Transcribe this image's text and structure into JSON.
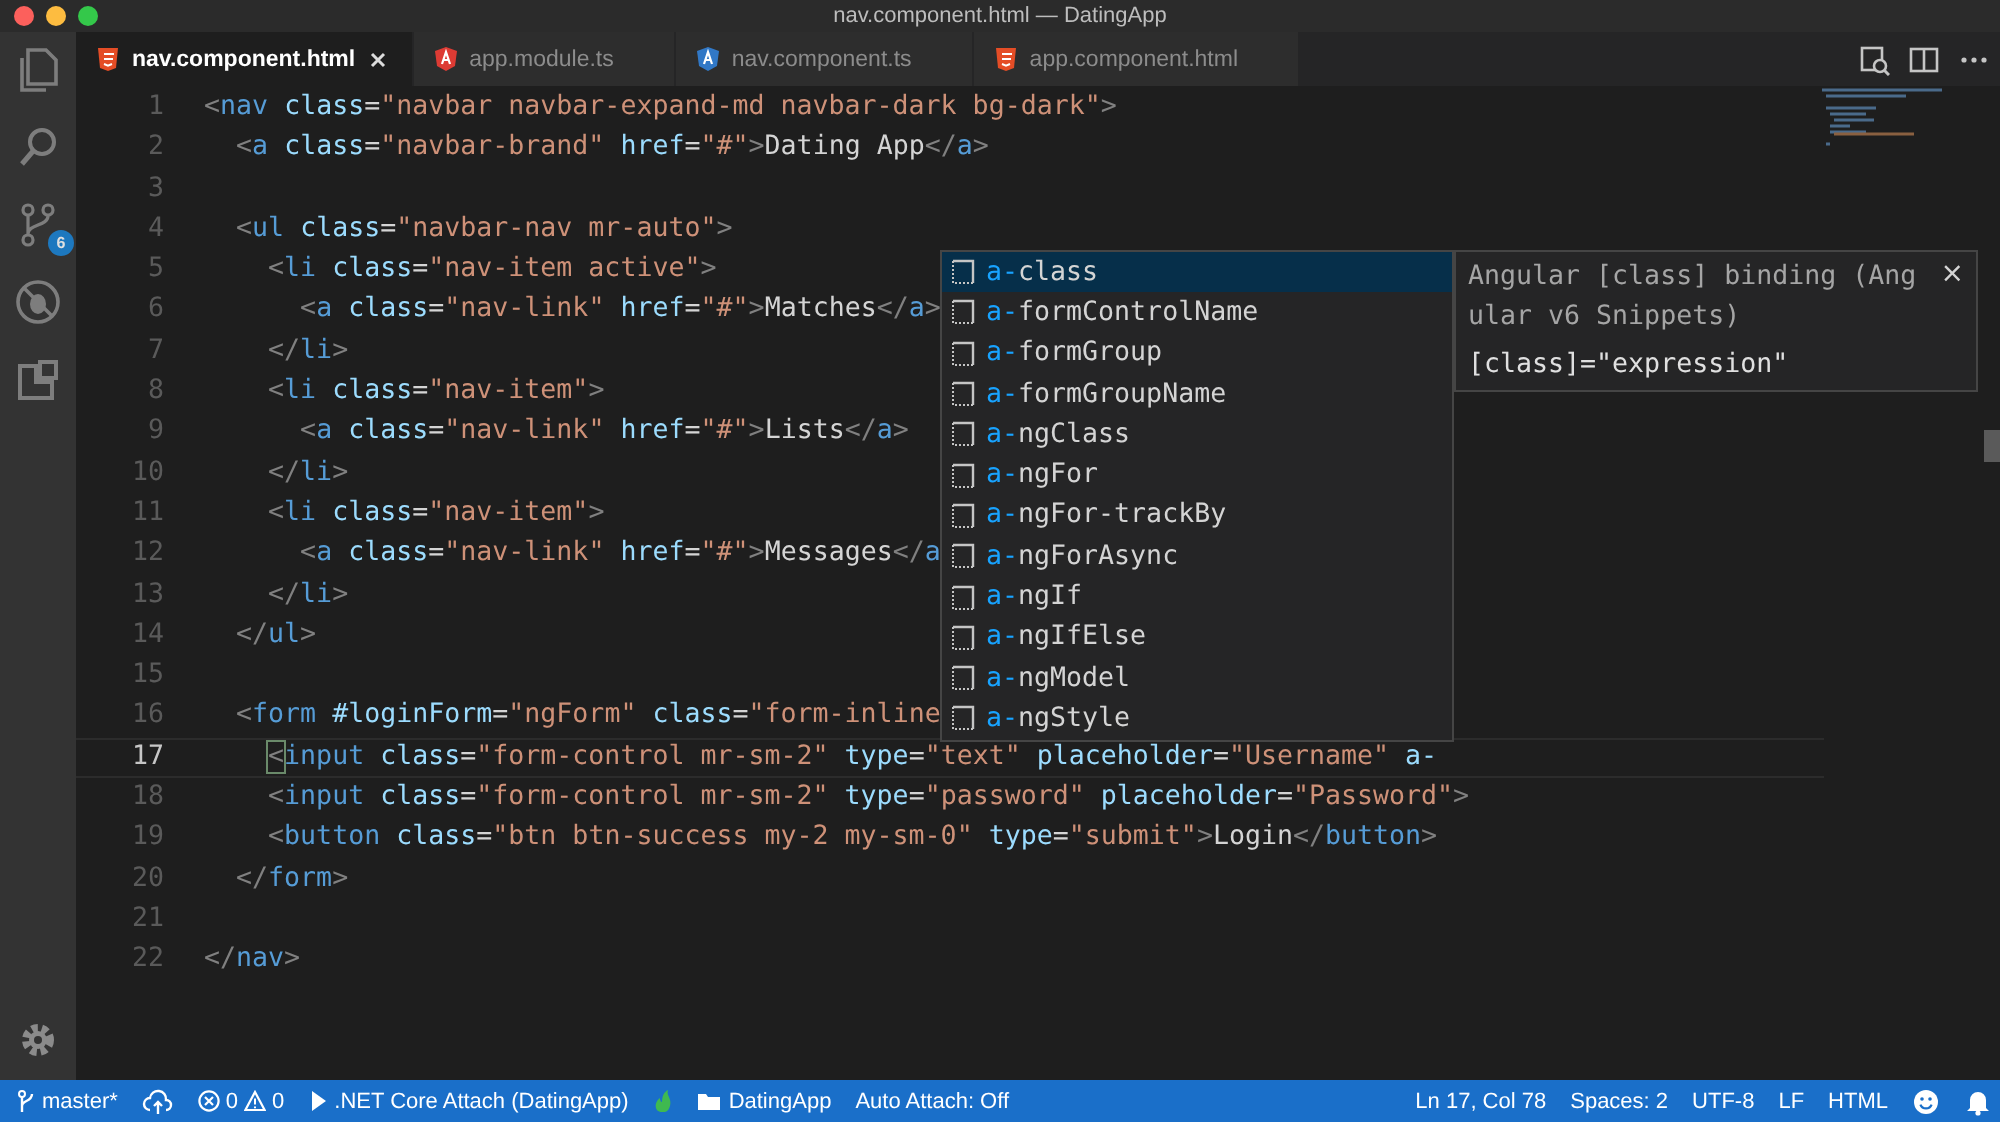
{
  "window": {
    "title": "nav.component.html — DatingApp"
  },
  "activity_bar": {
    "items": [
      {
        "kind": "files",
        "selected": false
      },
      {
        "kind": "search",
        "selected": false
      },
      {
        "kind": "scm",
        "selected": false,
        "badge": "6"
      },
      {
        "kind": "debug",
        "selected": false
      },
      {
        "kind": "extensions",
        "selected": false
      }
    ],
    "bottom": [
      {
        "kind": "settings"
      }
    ]
  },
  "tabs": [
    {
      "label": "nav.component.html",
      "kind": "html",
      "selected": true
    },
    {
      "label": "app.module.ts",
      "kind": "angular",
      "selected": false
    },
    {
      "label": "nav.component.ts",
      "kind": "angular-ts",
      "selected": false
    },
    {
      "label": "app.component.html",
      "kind": "html",
      "selected": false
    }
  ],
  "tab_actions": [
    {
      "kind": "open-changes"
    },
    {
      "kind": "split"
    },
    {
      "kind": "more"
    }
  ],
  "editor": {
    "lines": [
      {
        "number": "1",
        "current": false,
        "text": "<nav class=\"navbar navbar-expand-md navbar-dark bg-dark\">"
      },
      {
        "number": "2",
        "current": false,
        "text": "  <a class=\"navbar-brand\" href=\"#\">Dating App</a>"
      },
      {
        "number": "3",
        "current": false
      },
      {
        "number": "4",
        "current": false,
        "text": "  <ul class=\"navbar-nav mr-auto\">"
      },
      {
        "number": "5",
        "current": false,
        "text": "    <li class=\"nav-item active\">"
      },
      {
        "number": "6",
        "current": false,
        "text": "      <a class=\"nav-link\" href=\"#\">Matches</a>"
      },
      {
        "number": "7",
        "current": false,
        "text": "    </li>"
      },
      {
        "number": "8",
        "current": false,
        "text": "    <li class=\"nav-item\">"
      },
      {
        "number": "9",
        "current": false,
        "text": "      <a class=\"nav-link\" href=\"#\">Lists</a>"
      },
      {
        "number": "10",
        "current": false,
        "text": "    </li>"
      },
      {
        "number": "11",
        "current": false,
        "text": "    <li class=\"nav-item\">"
      },
      {
        "number": "12",
        "current": false,
        "text": "      <a class=\"nav-link\" href=\"#\">Messages</a"
      },
      {
        "number": "13",
        "current": false,
        "text": "    </li>"
      },
      {
        "number": "14",
        "current": false,
        "text": "  </ul>"
      },
      {
        "number": "15",
        "current": false
      },
      {
        "number": "16",
        "current": false,
        "text": "  <form #loginForm=\"ngForm\" class=\"form-inline"
      },
      {
        "number": "17",
        "current": true,
        "text": "    <input class=\"form-control mr-sm-2\" type=\"text\" placeholder=\"Username\" a-"
      },
      {
        "number": "18",
        "current": false,
        "text": "    <input class=\"form-control mr-sm-2\" type=\"password\" placeholder=\"Password\">"
      },
      {
        "number": "19",
        "current": false,
        "text": "    <button class=\"btn btn-success my-2 my-sm-0\" type=\"submit\">Login</button>"
      },
      {
        "number": "20",
        "current": false,
        "text": "  </form>"
      },
      {
        "number": "21",
        "current": false
      },
      {
        "number": "22",
        "current": false,
        "text": "</nav>"
      }
    ]
  },
  "suggestions": {
    "items": [
      {
        "match": "a-",
        "rest": "class",
        "selected": true
      },
      {
        "match": "a-",
        "rest": "formControlName",
        "selected": false
      },
      {
        "match": "a-",
        "rest": "formGroup",
        "selected": false
      },
      {
        "match": "a-",
        "rest": "formGroupName",
        "selected": false
      },
      {
        "match": "a-",
        "rest": "ngClass",
        "selected": false
      },
      {
        "match": "a-",
        "rest": "ngFor",
        "selected": false
      },
      {
        "match": "a-",
        "rest": "ngFor-trackBy",
        "selected": false
      },
      {
        "match": "a-",
        "rest": "ngForAsync",
        "selected": false
      },
      {
        "match": "a-",
        "rest": "ngIf",
        "selected": false
      },
      {
        "match": "a-",
        "rest": "ngIfElse",
        "selected": false
      },
      {
        "match": "a-",
        "rest": "ngModel",
        "selected": false
      },
      {
        "match": "a-",
        "rest": "ngStyle",
        "selected": false
      }
    ],
    "detail": {
      "title": "Angular [class] binding (Angular v6 Snippets)",
      "close": "×",
      "body": "[class]=\"expression\""
    }
  },
  "status_bar": {
    "left": [
      {
        "kind": "branch",
        "text": "master*"
      },
      {
        "kind": "sync"
      },
      {
        "kind": "problems",
        "errors": "0",
        "warnings": "0"
      },
      {
        "kind": "debug",
        "text": ".NET Core Attach (DatingApp)"
      },
      {
        "kind": "flame"
      },
      {
        "kind": "folder",
        "text": "DatingApp"
      },
      {
        "kind": "text",
        "text": "Auto Attach: Off"
      }
    ],
    "right": [
      {
        "kind": "text",
        "text": "Ln 17, Col 78"
      },
      {
        "kind": "text",
        "text": "Spaces: 2"
      },
      {
        "kind": "text",
        "text": "UTF-8"
      },
      {
        "kind": "text",
        "text": "LF"
      },
      {
        "kind": "text",
        "text": "HTML"
      },
      {
        "kind": "smiley"
      },
      {
        "kind": "bell"
      }
    ]
  }
}
